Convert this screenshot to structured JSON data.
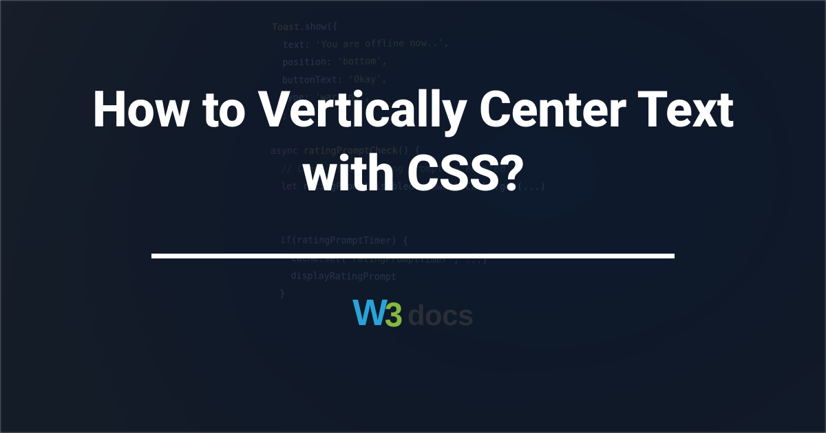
{
  "title": "How to Vertically Center Text with CSS?",
  "logo": {
    "part1": "W",
    "part2": "3",
    "part3": "docs"
  },
  "colors": {
    "title": "#ffffff",
    "divider": "#ffffff",
    "logo_w": "#2aa3d8",
    "logo_3": "#86b93f",
    "logo_docs": "#2a2f36"
  }
}
